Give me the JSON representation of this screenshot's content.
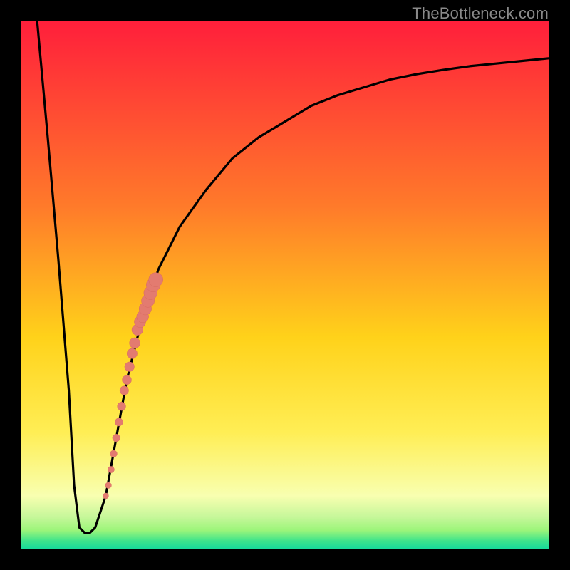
{
  "watermark": "TheBottleneck.com",
  "colors": {
    "gradient_top": "#ff1f3b",
    "gradient_mid_upper": "#ff6a2a",
    "gradient_mid": "#ffd21a",
    "gradient_mid_lower": "#ffee55",
    "gradient_low": "#f8ffb0",
    "gradient_green1": "#9cf57a",
    "gradient_green2": "#3fe48b",
    "gradient_green3": "#18db9a",
    "curve": "#000000",
    "dot_fill": "#e37b70",
    "dot_stroke": "#d86a60"
  },
  "chart_data": {
    "type": "line",
    "title": "",
    "xlabel": "",
    "ylabel": "",
    "xlim": [
      0,
      100
    ],
    "ylim": [
      0,
      100
    ],
    "series": [
      {
        "name": "bottleneck-curve",
        "x": [
          3,
          5,
          7,
          9,
          10,
          11,
          12,
          13,
          14,
          16,
          18,
          20,
          23,
          26,
          30,
          35,
          40,
          45,
          50,
          55,
          60,
          65,
          70,
          75,
          80,
          85,
          90,
          95,
          100
        ],
        "y": [
          100,
          78,
          55,
          30,
          12,
          4,
          3,
          3,
          4,
          10,
          21,
          32,
          44,
          53,
          61,
          68,
          74,
          78,
          81,
          84,
          86,
          87.5,
          89,
          90,
          90.8,
          91.5,
          92,
          92.5,
          93
        ]
      }
    ],
    "dots": {
      "name": "highlight-points",
      "x": [
        16,
        16.5,
        17,
        17.5,
        18,
        18.5,
        19,
        19.5,
        20,
        20.5,
        21,
        21.5,
        22,
        22.5,
        23,
        23.5,
        24,
        24.5,
        25,
        25.5
      ],
      "y": [
        10,
        12,
        15,
        18,
        21,
        24,
        27,
        30,
        32,
        34.5,
        37,
        39,
        41.5,
        43,
        44,
        45.5,
        47,
        48.5,
        50,
        51
      ]
    }
  }
}
